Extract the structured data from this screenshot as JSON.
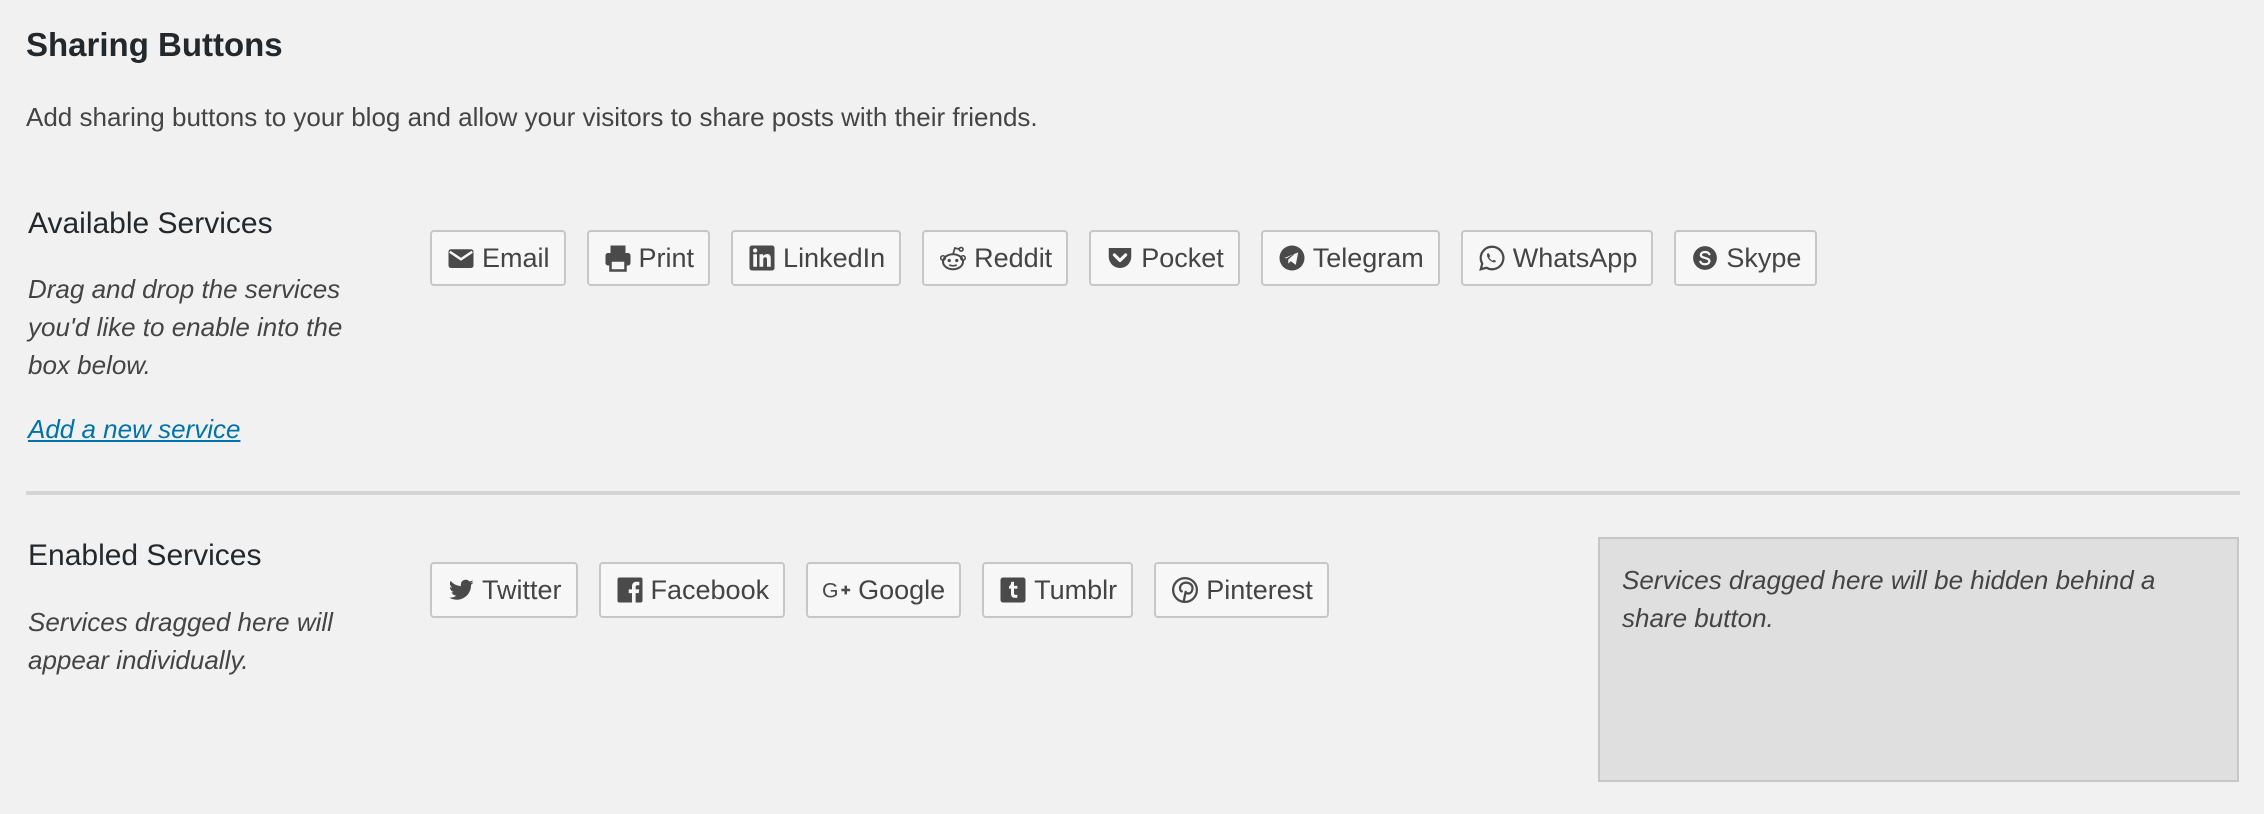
{
  "header": {
    "title": "Sharing Buttons",
    "description": "Add sharing buttons to your blog and allow your visitors to share posts with their friends."
  },
  "available": {
    "heading": "Available Services",
    "help": "Drag and drop the services you'd like to enable into the box below.",
    "add_link": "Add a new service",
    "services": [
      {
        "label": "Email",
        "icon": "envelope-icon"
      },
      {
        "label": "Print",
        "icon": "printer-icon"
      },
      {
        "label": "LinkedIn",
        "icon": "linkedin-icon"
      },
      {
        "label": "Reddit",
        "icon": "reddit-icon"
      },
      {
        "label": "Pocket",
        "icon": "pocket-icon"
      },
      {
        "label": "Telegram",
        "icon": "telegram-icon"
      },
      {
        "label": "WhatsApp",
        "icon": "whatsapp-icon"
      },
      {
        "label": "Skype",
        "icon": "skype-icon"
      }
    ]
  },
  "enabled": {
    "heading": "Enabled Services",
    "help": "Services dragged here will appear individually.",
    "services": [
      {
        "label": "Twitter",
        "icon": "twitter-icon"
      },
      {
        "label": "Facebook",
        "icon": "facebook-icon"
      },
      {
        "label": "Google",
        "icon": "google-plus-icon"
      },
      {
        "label": "Tumblr",
        "icon": "tumblr-icon"
      },
      {
        "label": "Pinterest",
        "icon": "pinterest-icon"
      }
    ],
    "hidden_box_text": "Services dragged here will be hidden behind a share button."
  },
  "colors": {
    "background": "#f1f1f1",
    "link": "#0073aa",
    "icon": "#4a4a4a",
    "hidden_box": "#dfdfdf"
  }
}
